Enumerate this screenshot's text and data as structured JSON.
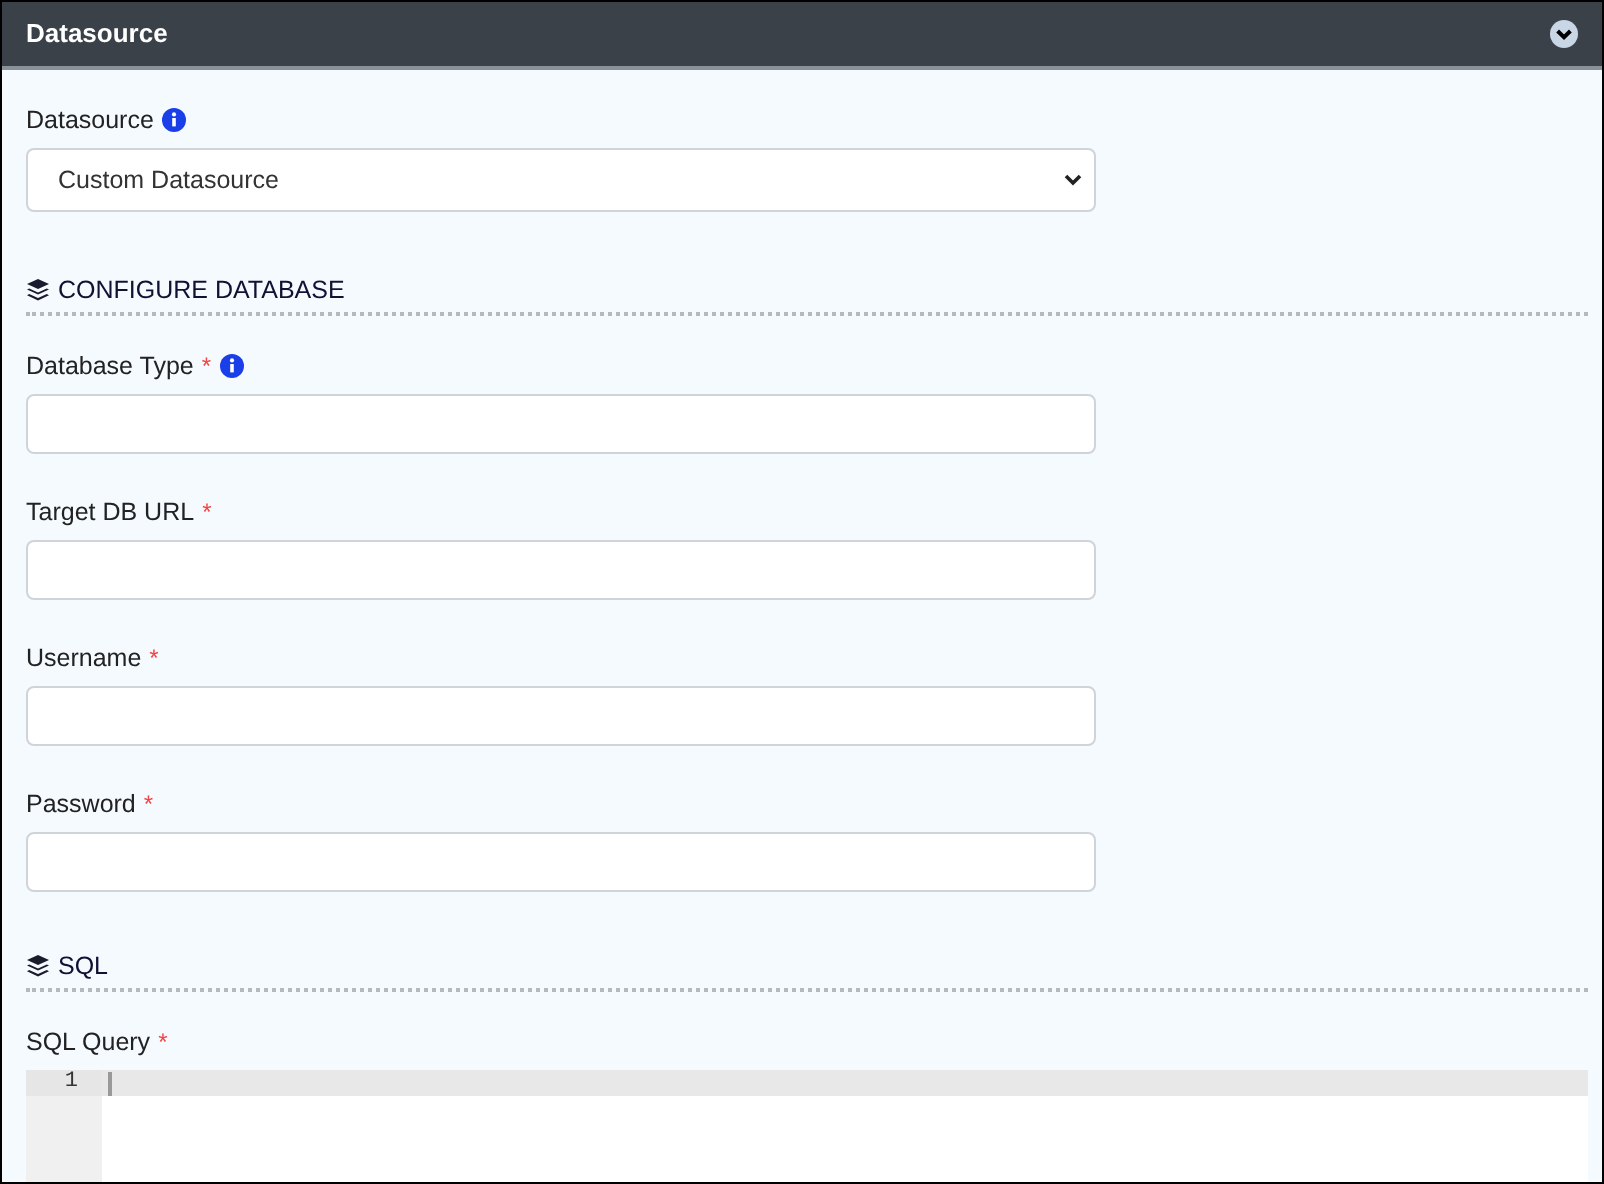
{
  "panel": {
    "title": "Datasource"
  },
  "fields_top": [
    {
      "kind": "select",
      "label": "Datasource",
      "info": true,
      "value": "Custom Datasource"
    }
  ],
  "sections": [
    {
      "title": "CONFIGURE DATABASE",
      "fields": [
        {
          "kind": "text",
          "label": "Database Type",
          "required_mark": "*",
          "info": true
        },
        {
          "kind": "text",
          "label": "Target DB URL",
          "required_mark": "*",
          "info": false
        },
        {
          "kind": "text",
          "label": "Username",
          "required_mark": "*",
          "info": false
        },
        {
          "kind": "text",
          "label": "Password",
          "required_mark": "*",
          "info": false
        }
      ]
    },
    {
      "title": "SQL",
      "fields": [
        {
          "kind": "code",
          "label": "SQL Query",
          "required_mark": "*",
          "info": false,
          "line_numbers": [
            "1"
          ]
        }
      ]
    }
  ]
}
